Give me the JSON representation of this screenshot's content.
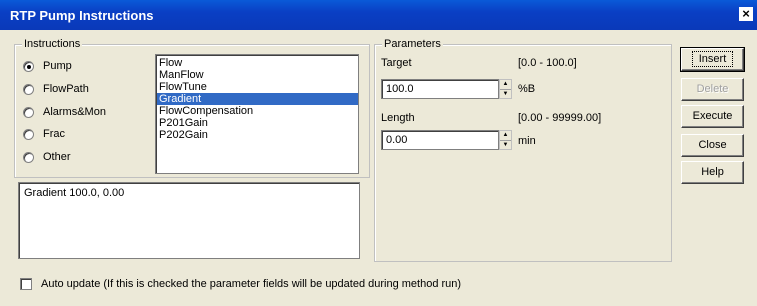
{
  "window": {
    "title": "RTP Pump Instructions",
    "close_glyph": "×"
  },
  "instructions": {
    "label": "Instructions",
    "radios": [
      {
        "label": "Pump",
        "selected": true
      },
      {
        "label": "FlowPath",
        "selected": false
      },
      {
        "label": "Alarms&Mon",
        "selected": false
      },
      {
        "label": "Frac",
        "selected": false
      },
      {
        "label": "Other",
        "selected": false
      }
    ],
    "list": [
      "Flow",
      "ManFlow",
      "FlowTune",
      "Gradient",
      "FlowCompensation",
      "P201Gain",
      "P202Gain"
    ],
    "selected_item": "Gradient",
    "summary": "Gradient 100.0, 0.00"
  },
  "parameters": {
    "label": "Parameters",
    "target": {
      "label": "Target",
      "range": "[0.0 - 100.0]",
      "value": "100.0",
      "unit": "%B"
    },
    "length": {
      "label": "Length",
      "range": "[0.00 - 99999.00]",
      "value": "0.00",
      "unit": "min"
    }
  },
  "buttons": {
    "insert": "Insert",
    "delete": "Delete",
    "execute": "Execute",
    "close": "Close",
    "help": "Help"
  },
  "auto_update": {
    "label": "Auto update (If this is checked the parameter fields will be updated during method run)",
    "checked": false
  },
  "colors": {
    "titlebar": "#0a3fc4",
    "selection": "#316ac5",
    "dialog": "#ece9d8"
  }
}
